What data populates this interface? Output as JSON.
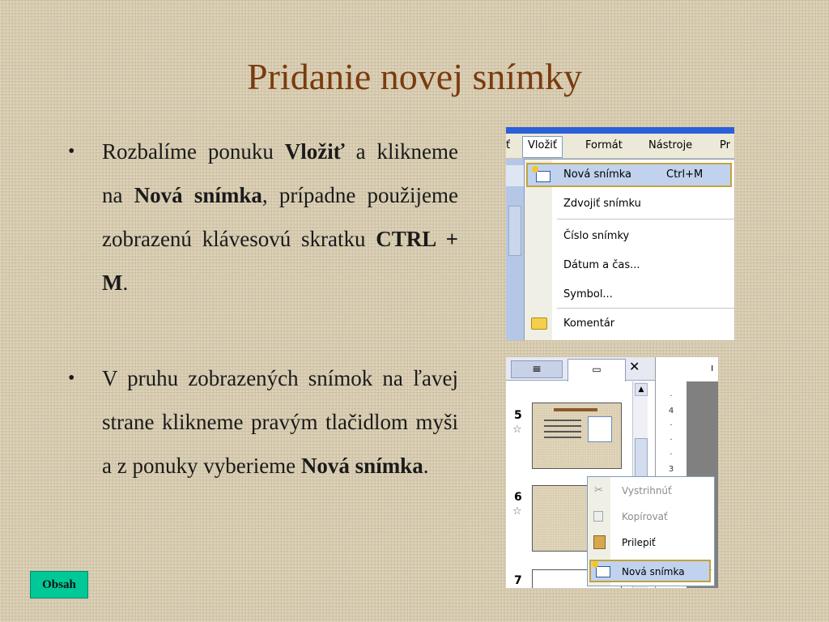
{
  "slide": {
    "title": "Pridanie novej snímky",
    "bullet_char": "•",
    "bullet1": {
      "t1": "Rozbalíme ponuku ",
      "b1": "Vložiť",
      "t2": " a klikneme na ",
      "b2": "Nová snímka",
      "t3": ", prípadne použijeme zobrazenú klávesovú skratku ",
      "b3": "CTRL + M",
      "t4": "."
    },
    "bullet2": {
      "t1": "V pruhu zobrazených snímok na ľavej strane klikneme pravým tlačidlom myši a z ponuky vyberieme ",
      "b1": "Nová snímka",
      "t2": "."
    },
    "obsah_button": "Obsah"
  },
  "screenshot1": {
    "menubar": {
      "left_fragment": "ť",
      "insert": "Vložiť",
      "format": "Formát",
      "tools": "Nástroje",
      "right_fragment": "Pr"
    },
    "menu": {
      "new_slide": "Nová snímka",
      "new_slide_shortcut": "Ctrl+M",
      "duplicate_slide": "Zdvojiť snímku",
      "slide_number": "Číslo snímky",
      "date_time": "Dátum a čas...",
      "symbol": "Symbol...",
      "comment": "Komentár"
    }
  },
  "screenshot2": {
    "tab_outline_icon": "outline-lines-icon",
    "tab_slides_icon": "slide-icon",
    "close": "✕",
    "right_pipe": "ı",
    "ruler_labels": [
      "·",
      "4",
      "·",
      "·",
      "·",
      "3",
      "·",
      "·"
    ],
    "slide_numbers": [
      "5",
      "6",
      "7"
    ],
    "star": "☆",
    "context_menu": {
      "cut": "Vystrihnúť",
      "copy": "Kopírovať",
      "paste": "Prilepiť",
      "new_slide": "Nová snímka"
    }
  }
}
